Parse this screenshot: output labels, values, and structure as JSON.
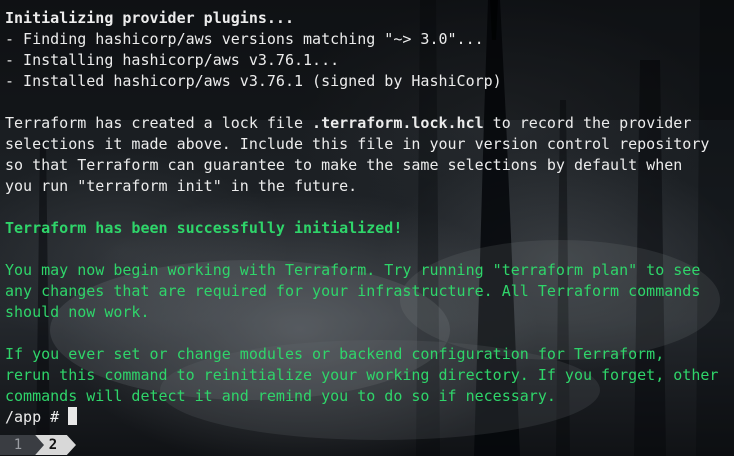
{
  "terminal": {
    "lines": [
      {
        "text": "Initializing provider plugins...",
        "style": "bold white"
      },
      {
        "text": "- Finding hashicorp/aws versions matching \"~> 3.0\"...",
        "style": "white"
      },
      {
        "text": "- Installing hashicorp/aws v3.76.1...",
        "style": "white"
      },
      {
        "text": "- Installed hashicorp/aws v3.76.1 (signed by HashiCorp)",
        "style": "white"
      },
      {
        "text": "",
        "style": "white"
      },
      {
        "text_before": "Terraform has created a lock file ",
        "text_bold": ".terraform.lock.hcl",
        "text_after": " to record the provider",
        "style": "white"
      },
      {
        "text": "selections it made above. Include this file in your version control repository",
        "style": "white"
      },
      {
        "text": "so that Terraform can guarantee to make the same selections by default when",
        "style": "white"
      },
      {
        "text": "you run \"terraform init\" in the future.",
        "style": "white"
      },
      {
        "text": "",
        "style": "white"
      },
      {
        "text": "Terraform has been successfully initialized!",
        "style": "bold green"
      },
      {
        "text": "",
        "style": "white"
      },
      {
        "text": "You may now begin working with Terraform. Try running \"terraform plan\" to see",
        "style": "green"
      },
      {
        "text": "any changes that are required for your infrastructure. All Terraform commands",
        "style": "green"
      },
      {
        "text": "should now work.",
        "style": "green"
      },
      {
        "text": "",
        "style": "white"
      },
      {
        "text": "If you ever set or change modules or backend configuration for Terraform,",
        "style": "green"
      },
      {
        "text": "rerun this command to reinitialize your working directory. If you forget, other",
        "style": "green"
      },
      {
        "text": "commands will detect it and remind you to do so if necessary.",
        "style": "green"
      }
    ],
    "prompt": "/app # "
  },
  "tabs": [
    {
      "label": "1",
      "active": false
    },
    {
      "label": "2",
      "active": true
    }
  ],
  "colors": {
    "green": "#2fd56a",
    "text": "#e8e8e8",
    "tab_active": "#d8d8d8",
    "tab_inactive": "#3a3d42"
  }
}
